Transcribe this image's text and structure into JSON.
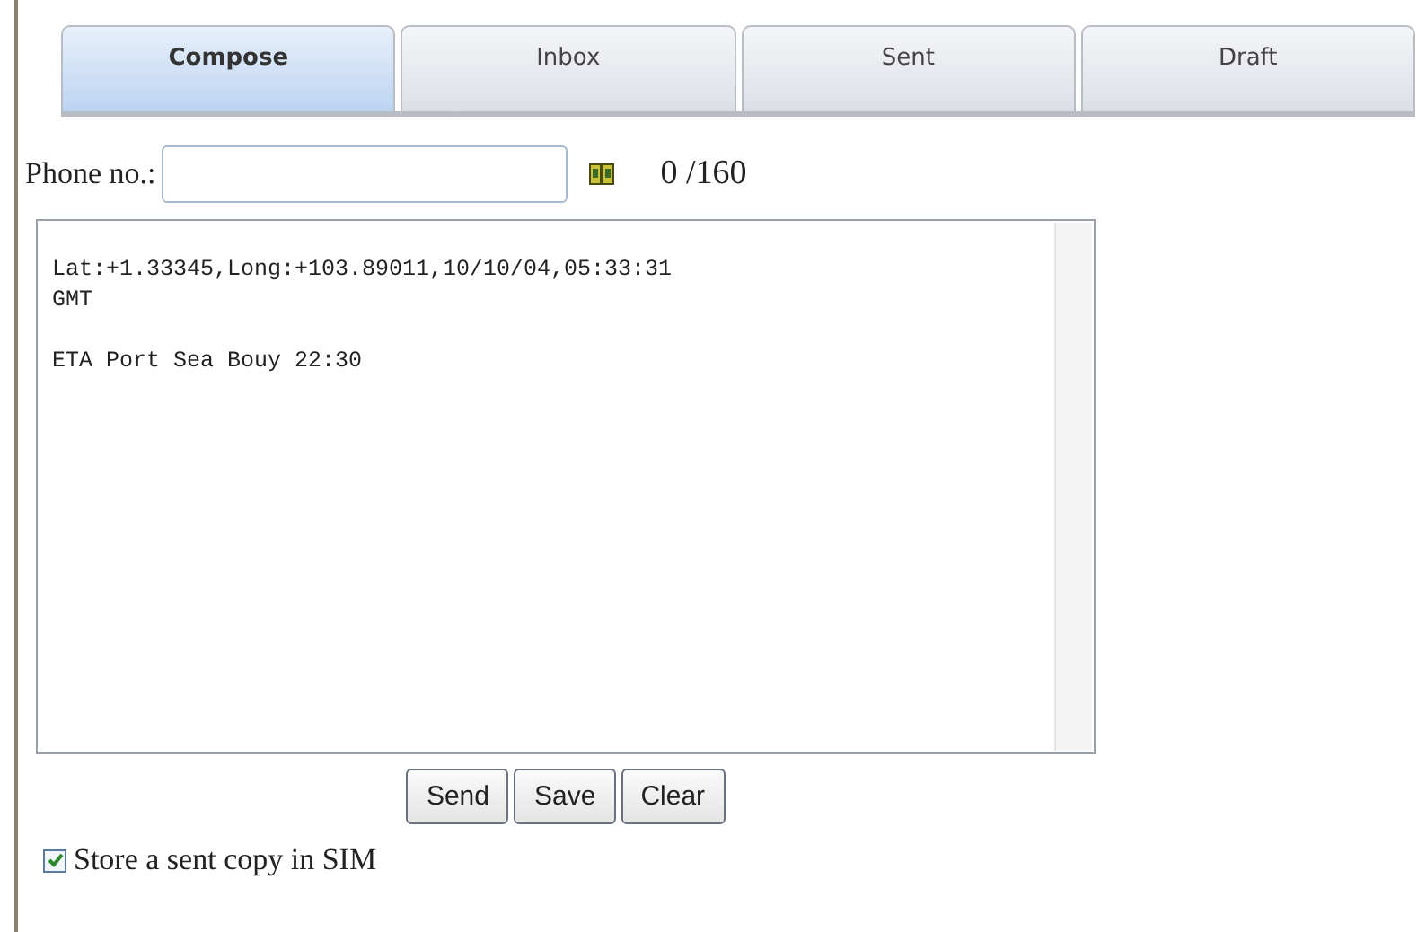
{
  "tabs": [
    {
      "label": "Compose",
      "selected": true
    },
    {
      "label": "Inbox",
      "selected": false
    },
    {
      "label": "Sent",
      "selected": false
    },
    {
      "label": "Draft",
      "selected": false
    }
  ],
  "phone": {
    "label": "Phone no.:"
  },
  "counter": "0 /160",
  "message": {
    "value": "Lat:+1.33345,Long:+103.89011,10/10/04,05:33:31\nGMT\n\nETA Port Sea Bouy 22:30"
  },
  "buttons": [
    "Send",
    "Save",
    "Clear"
  ],
  "store_copy": {
    "label": "Store a sent copy in SIM",
    "checked": true
  }
}
